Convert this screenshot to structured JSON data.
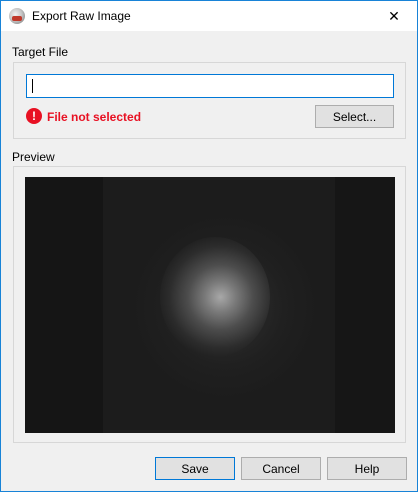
{
  "window": {
    "title": "Export Raw Image"
  },
  "target_file": {
    "label": "Target File",
    "value": "",
    "error": "File not selected",
    "select_button": "Select..."
  },
  "preview": {
    "label": "Preview"
  },
  "buttons": {
    "save": "Save",
    "cancel": "Cancel",
    "help": "Help"
  },
  "icons": {
    "close": "close-icon",
    "error": "error-icon",
    "app": "app-icon"
  },
  "colors": {
    "error": "#e81123",
    "accent": "#0078d7"
  }
}
